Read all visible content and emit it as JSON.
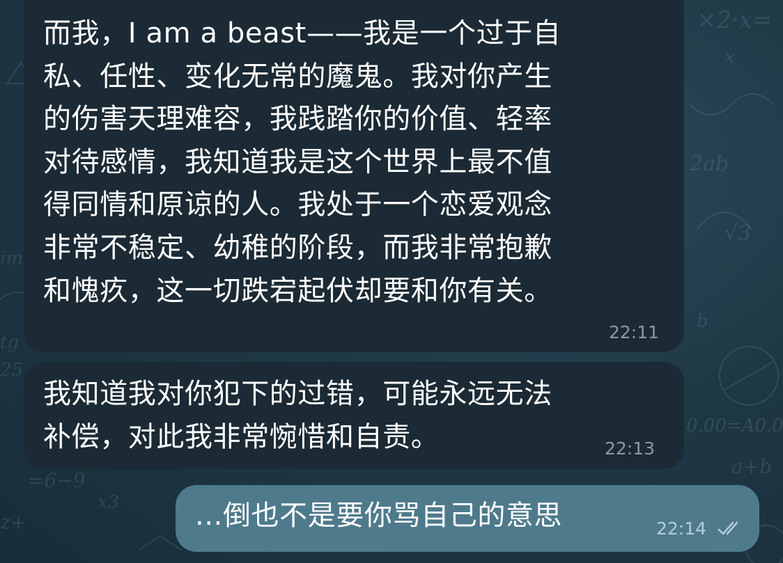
{
  "messages": [
    {
      "direction": "incoming",
      "lines": [
        "而我，I am a beast——我是一个过于自",
        "私、任性、变化无常的魔鬼。我对你产生",
        "的伤害天理难容，我践踏你的价值、轻率",
        "对待感情，我知道我是这个世界上最不值",
        "得同情和原谅的人。我处于一个恋爱观念",
        "非常不稳定、幼稚的阶段，而我非常抱歉",
        "和愧疚，这一切跌宕起伏却要和你有关。"
      ],
      "time": "22:11"
    },
    {
      "direction": "incoming",
      "lines": [
        "我知道我对你犯下的过错，可能永远无法",
        "补偿，对此我非常惋惜和自责。"
      ],
      "time": "22:13"
    },
    {
      "direction": "outgoing",
      "lines": [
        "...倒也不是要你骂自己的意思"
      ],
      "time": "22:14",
      "status_icon": "double-check-read-icon"
    }
  ],
  "theme": {
    "incoming_bubble": "#1b2a34",
    "outgoing_bubble": "#4e7a8c",
    "text": "#ffffff",
    "time_incoming": "#8a9aa4",
    "time_outgoing": "#b5ccd6",
    "background": "#1f3846"
  }
}
